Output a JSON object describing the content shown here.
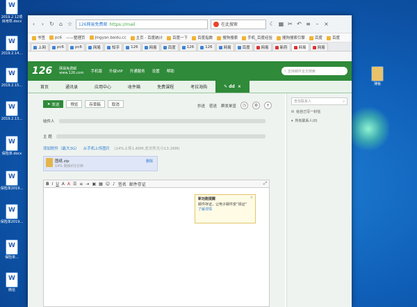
{
  "desktop": {
    "icons": [
      {
        "label": "2019.2.12项目用草.docx"
      },
      {
        "label": "2019.2.14..."
      },
      {
        "label": "2019.2.15..."
      },
      {
        "label": "2019.2.13..."
      },
      {
        "label": "保险单.docx"
      },
      {
        "label": "保险单2019..."
      },
      {
        "label": "保险单2019..."
      },
      {
        "label": "保险单..."
      },
      {
        "label": "微信"
      },
      {
        "label": "薄板"
      }
    ]
  },
  "browser": {
    "address": {
      "site": "126网易免费邮",
      "url": "https://mail"
    },
    "search_placeholder": "在此搜索",
    "bookmarks": [
      "书签",
      "pc6",
      "——整理页",
      "jingyan.baidu.cc",
      "主页 - 百度统计",
      "百度一下",
      "百度指数",
      "搜狗搜索",
      "手机_百度经验",
      "搜狗搜索引擎",
      "百度",
      "百度"
    ],
    "tabs": [
      "上网",
      "pc6",
      "pc6",
      "网易",
      "知乎",
      "126",
      "网易",
      "百度",
      "126",
      "126",
      "网易",
      "百度",
      "网易",
      "新药",
      "网易",
      "网易"
    ]
  },
  "mail": {
    "logo": "126",
    "logo_sub": "网易免费邮\nwww.126.com",
    "header_links": [
      "手机版",
      "升级VIP",
      "开通服务",
      "设置",
      "帮助"
    ],
    "search_placeholder": "支持邮件全文搜索",
    "nav_tabs": [
      "首页",
      "通讯录",
      "应用中心",
      "收件箱",
      "免费课程",
      "考拉海购"
    ],
    "active_tab": "dd",
    "actions": {
      "send": "发送",
      "preview": "预览",
      "save_draft": "存草稿",
      "cancel": "取消"
    },
    "top_links": [
      "抄送",
      "密送",
      "群发单显"
    ],
    "fields": {
      "to": "收件人",
      "subject": "主 题"
    },
    "attach": {
      "add": "添加附件（最大3G）",
      "from_phone": "从手机上传图片",
      "note": "(14%上传1.86M,总文件大小13.26M)",
      "name": "图纸.zip",
      "meta": "14%  剩余约1分钟",
      "delete": "删除"
    },
    "editor_labels": {
      "signature": "签名",
      "evidence": "邮件存证"
    },
    "popup": {
      "title": "新功能提醒",
      "body": "邮件存证，让电子邮件变“铁证”",
      "link": "了解详情"
    },
    "sidebar": {
      "search_placeholder": "查找联系人",
      "items": [
        "给自己写一封信",
        "所有联系人(0)"
      ]
    }
  }
}
